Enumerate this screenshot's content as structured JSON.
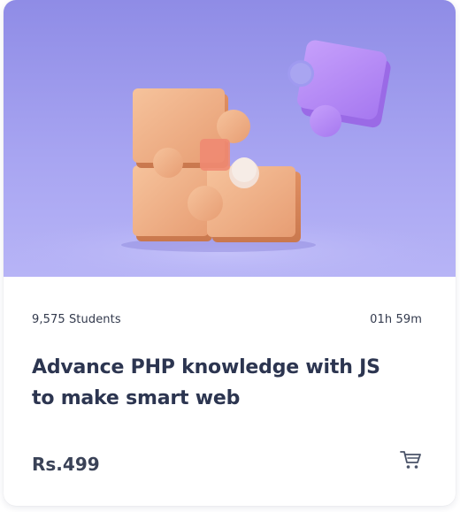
{
  "course": {
    "students": "9,575 Students",
    "duration": "01h 59m",
    "title": "Advance PHP knowledge with JS to make smart web",
    "price": "Rs.499"
  },
  "icons": {
    "cart": "shopping-cart-icon"
  },
  "colors": {
    "thumbnail_bg": "#a9a5f1",
    "puzzle_orange": "#eeaa80",
    "puzzle_purple": "#b78bf5",
    "title_text": "#2c3550",
    "price_text": "#3a4257",
    "cart_icon": "#4a5368"
  }
}
